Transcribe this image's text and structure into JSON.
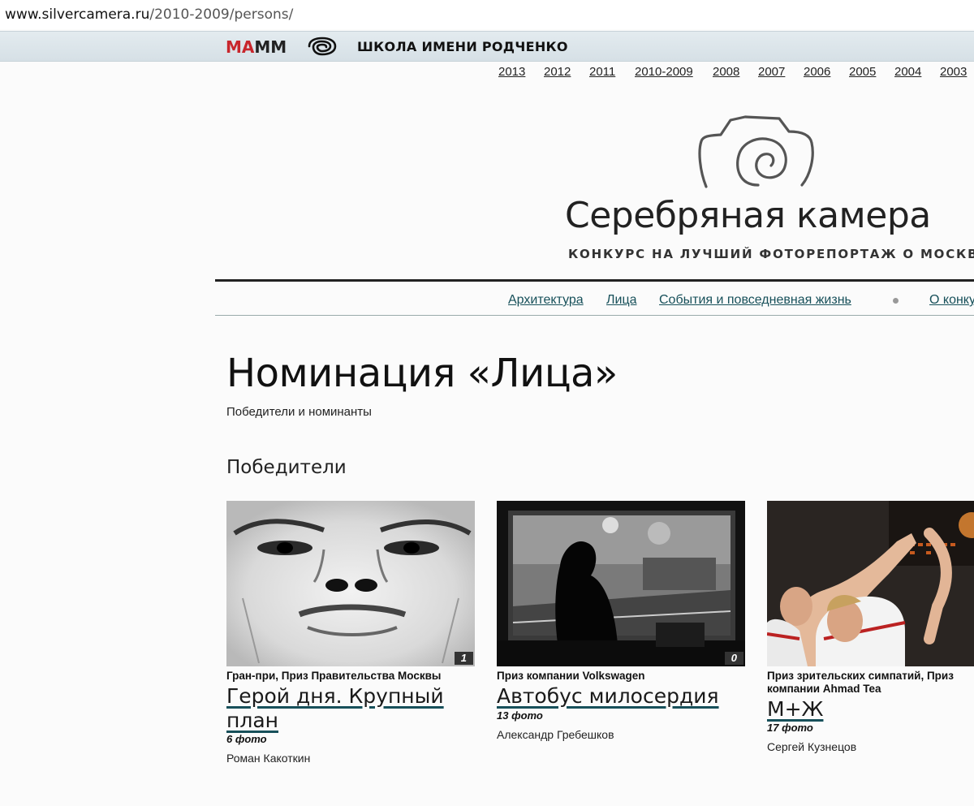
{
  "browser": {
    "url_host": "www.silvercamera.ru",
    "url_path": "/2010-2009/persons/"
  },
  "topbar": {
    "mamm_a": "МА",
    "mamm_b": "ММ",
    "school": "ШКОЛА ИМЕНИ РОДЧЕНКО"
  },
  "years": [
    "2013",
    "2012",
    "2011",
    "2010-2009",
    "2008",
    "2007",
    "2006",
    "2005",
    "2004",
    "2003"
  ],
  "site": {
    "title": "Серебряная камера",
    "subtitle": "КОНКУРС НА ЛУЧШИЙ ФОТОРЕПОРТАЖ О МОСКВЕ"
  },
  "nav": {
    "items": [
      "Архитектура",
      "Лица",
      "События и повседневная жизнь",
      "О конку"
    ]
  },
  "page": {
    "title": "Номинация «Лица»",
    "subtitle": "Победители и номинанты",
    "section": "Победители"
  },
  "cards": [
    {
      "count": "1",
      "prize": "Гран-при, Приз Правительства Москвы",
      "title_line1": "Герой дня. Крупный",
      "title_line2": "план",
      "photos": "6 фото",
      "author": "Роман Какоткин"
    },
    {
      "count": "0",
      "prize": "Приз компании Volkswagen",
      "title_line1": "Автобус милосердия",
      "title_line2": "",
      "photos": "13 фото",
      "author": "Александр Гребешков"
    },
    {
      "count": "",
      "prize": "Приз зрительских симпатий, Приз компании Ahmad Tea",
      "title_line1": "М+Ж",
      "title_line2": "",
      "photos": "17 фото",
      "author": "Сергей Кузнецов"
    }
  ],
  "colors": {
    "link": "#17505a",
    "accent": "#c8262c",
    "band": "#dbe4e9"
  },
  "icons": {
    "school_logo": "swirl-camera-icon",
    "site_logo": "camera-spiral-logo-icon"
  }
}
